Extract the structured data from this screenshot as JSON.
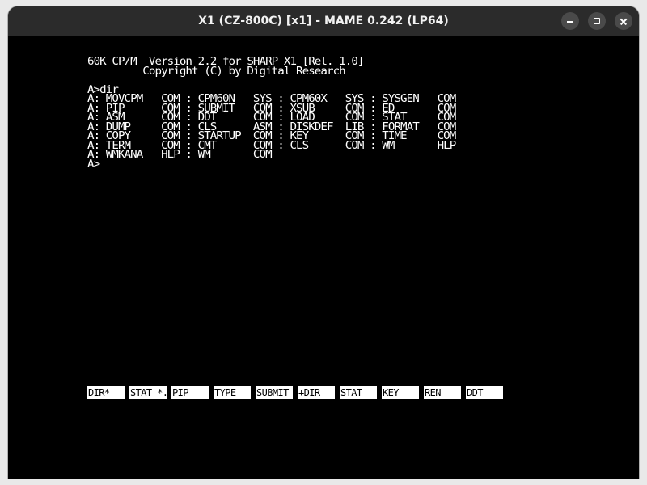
{
  "window": {
    "title": "X1 (CZ-800C) [x1] - MAME 0.242 (LP64)"
  },
  "terminal": {
    "header": [
      "60K CP/M  Version 2.2 for SHARP X1 [Rel. 1.0]",
      "         Copyright (C) by Digital Research"
    ],
    "command": "A>dir",
    "listing": [
      "A: MOVCPM   COM : CPM60N   SYS : CPM60X   SYS : SYSGEN   COM",
      "A: PIP      COM : SUBMIT   COM : XSUB     COM : ED       COM",
      "A: ASM      COM : DDT      COM : LOAD     COM : STAT     COM",
      "A: DUMP     COM : CLS      ASM : DISKDEF  LIB : FORMAT   COM",
      "A: COPY     COM : STARTUP  COM : KEY      COM : TIME     COM",
      "A: TERM     COM : CMT      COM : CLS      COM : WM       HLP",
      "A: WMKANA   HLP : WM       COM"
    ],
    "prompt": "A>"
  },
  "function_keys": [
    "DIR*",
    "STAT *.",
    "PIP",
    "TYPE",
    "SUBMIT",
    "+DIR",
    "STAT",
    "KEY",
    "REN",
    "DDT"
  ],
  "colors": {
    "screen_bg": "#000000",
    "text": "#ffffff",
    "titlebar": "#2b2b2b"
  }
}
